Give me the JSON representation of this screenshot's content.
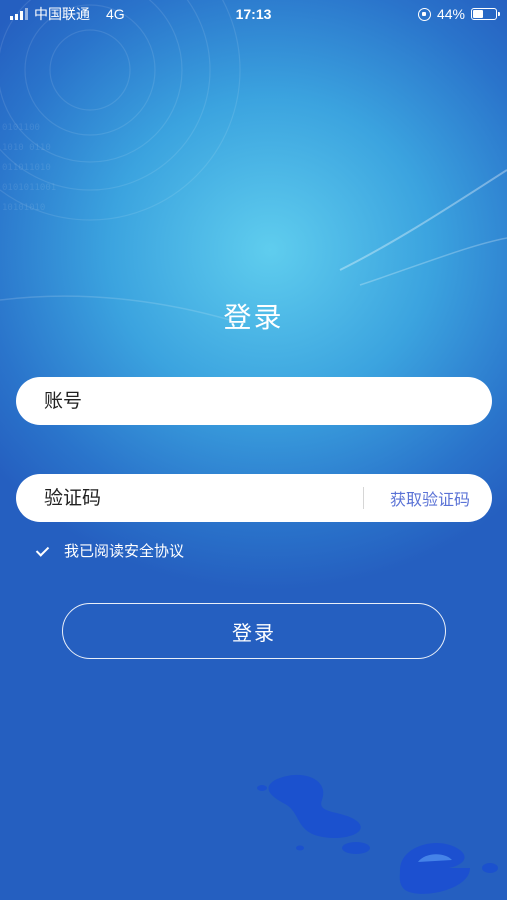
{
  "status_bar": {
    "carrier": "中国联通",
    "network": "4G",
    "time": "17:13",
    "battery": "44%",
    "battery_level": 0.44
  },
  "page": {
    "title": "登录"
  },
  "form": {
    "account_placeholder": "账号",
    "code_placeholder": "验证码",
    "get_code_label": "获取验证码",
    "agreement_label": "我已阅读安全协议",
    "agreement_checked": true,
    "login_label": "登录"
  },
  "colors": {
    "link": "#5b73d6",
    "background_center": "#5fcdee",
    "background_edge": "#255fc0"
  },
  "icons": [
    "signal-icon",
    "rotation-lock-icon",
    "battery-icon",
    "checkmark-icon"
  ]
}
